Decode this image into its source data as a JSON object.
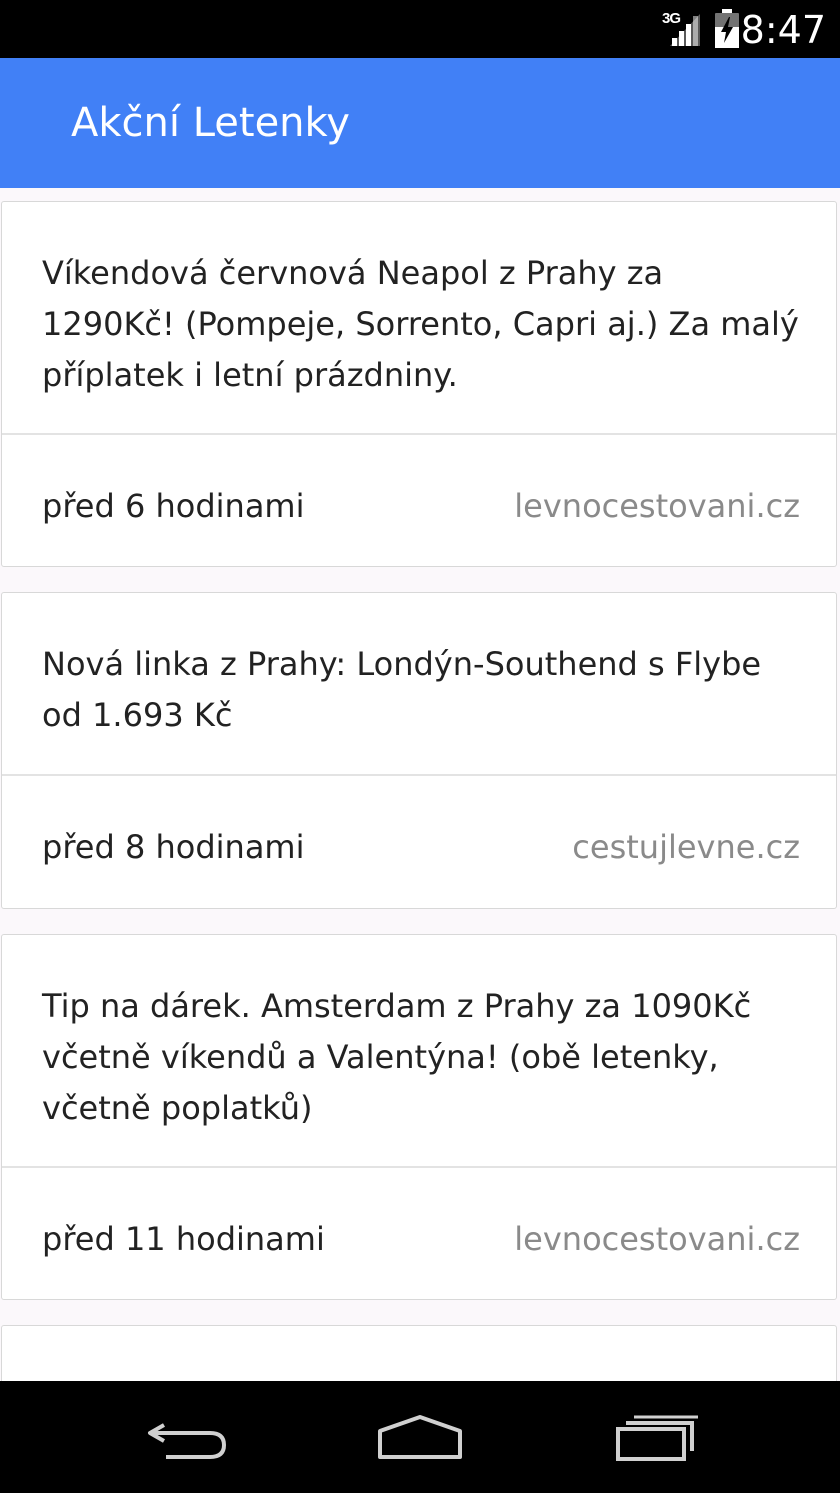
{
  "status_bar": {
    "network": "3G",
    "time": "8:47",
    "icons": [
      "signal-icon",
      "battery-charging-icon"
    ]
  },
  "app_bar": {
    "title": "Akční Letenky"
  },
  "cards": [
    {
      "title": "Víkendová červnová Neapol z Prahy za 1290Kč! (Pompeje, Sorrento, Capri aj.) Za malý příplatek i letní prázdniny.",
      "time": "před 6 hodinami",
      "source": "levnocestovani.cz"
    },
    {
      "title": "Nová linka z Prahy: Londýn-Southend s Flybe od 1.693 Kč",
      "time": "před 8 hodinami",
      "source": "cestujlevne.cz"
    },
    {
      "title": "Tip na dárek. Amsterdam z Prahy za 1090Kč včetně víkendů a Valentýna! (obě letenky, včetně poplatků)",
      "time": "před 11 hodinami",
      "source": "levnocestovani.cz"
    },
    {
      "title": "",
      "time": "",
      "source": ""
    }
  ],
  "nav_bar": {
    "icons": [
      "back-icon",
      "home-icon",
      "recent-apps-icon"
    ]
  }
}
